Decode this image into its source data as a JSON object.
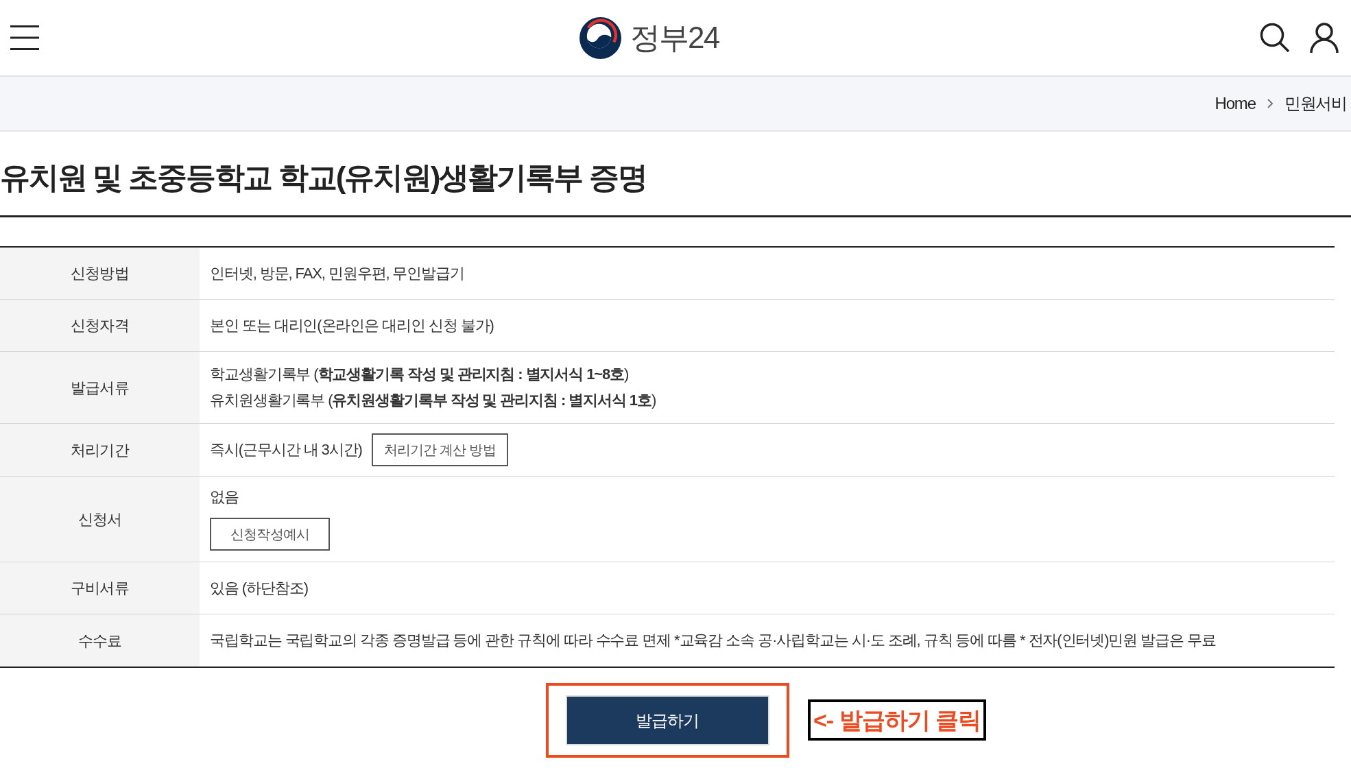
{
  "header": {
    "logo_text": "정부24"
  },
  "breadcrumb": [
    {
      "label": "Home"
    },
    {
      "label": "민원서비"
    }
  ],
  "page_title": "유치원 및 초중등학교 학교(유치원)생활기록부 증명",
  "info_rows": [
    {
      "kind": "text",
      "label": "신청방법",
      "lines": [
        "인터넷, 방문, FAX, 민원우편, 무인발급기"
      ]
    },
    {
      "kind": "text",
      "label": "신청자격",
      "lines": [
        "본인 또는 대리인(온라인은 대리인 신청 불가)"
      ]
    },
    {
      "kind": "text",
      "label": "발급서류",
      "lines": [
        "학교생활기록부 (**학교생활기록 작성 및 관리지침 : 별지서식 1~8호**)",
        "유치원생활기록부 (**유치원생활기록부 작성 및 관리지침 : 별지서식 1호**)"
      ]
    },
    {
      "kind": "button_inline",
      "label": "처리기간",
      "lines": [
        "즉시(근무시간 내 3시간)"
      ],
      "button": "처리기간 계산 방법"
    },
    {
      "kind": "button_below",
      "label": "신청서",
      "lines": [
        "없음"
      ],
      "button": "신청작성예시"
    },
    {
      "kind": "text",
      "label": "구비서류",
      "lines": [
        "있음 (하단참조)"
      ]
    },
    {
      "kind": "text",
      "label": "수수료",
      "lines": [
        "국립학교는 국립학교의 각종 증명발급 등에 관한 규칙에 따라 수수료 면제 *교육감 소속 공·사립학교는 시·도 조례, 규칙 등에 따름 * 전자(인터넷)민원 발급은 무료"
      ]
    }
  ],
  "issue_button": {
    "label": "발급하기",
    "highlighted": true
  },
  "annotation": {
    "text": "<- 발급하기 클릭"
  }
}
